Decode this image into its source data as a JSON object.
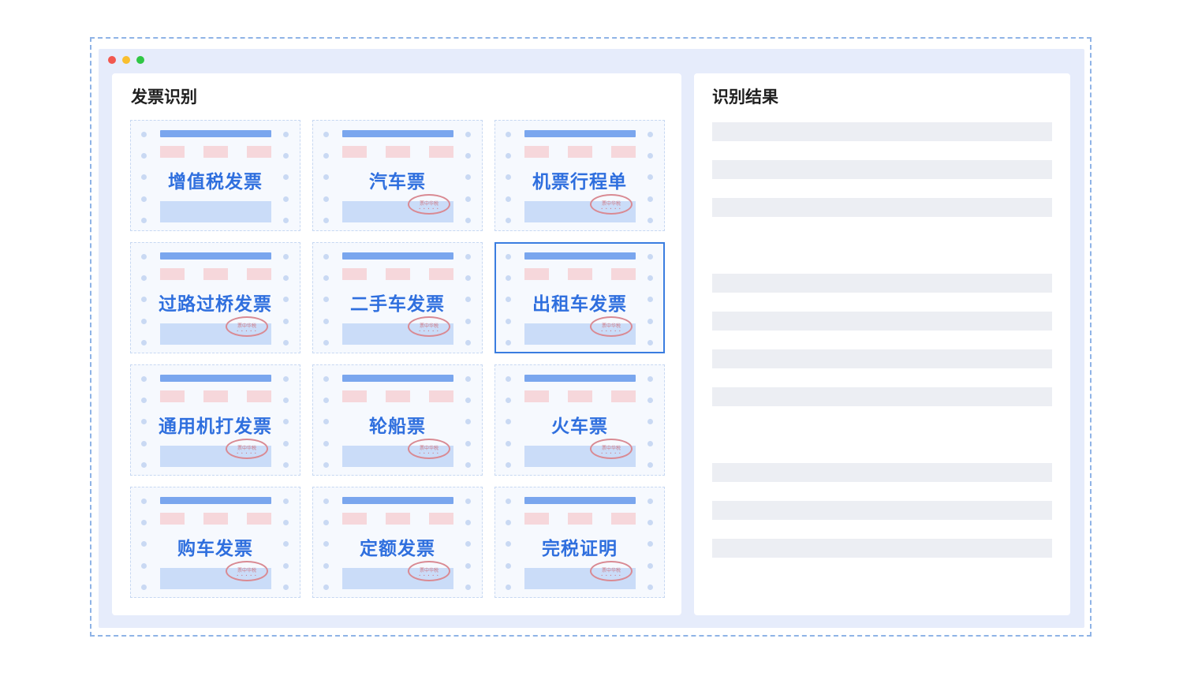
{
  "left_panel": {
    "title": "发票识别"
  },
  "right_panel": {
    "title": "识别结果"
  },
  "stamp_text": "票中华税",
  "stamp_stars": "• • • • •",
  "cards": [
    {
      "label": "增值税发票",
      "stamp": false,
      "selected": false
    },
    {
      "label": "汽车票",
      "stamp": true,
      "selected": false
    },
    {
      "label": "机票行程单",
      "stamp": true,
      "selected": false
    },
    {
      "label": "过路过桥发票",
      "stamp": true,
      "selected": false
    },
    {
      "label": "二手车发票",
      "stamp": true,
      "selected": false
    },
    {
      "label": "出租车发票",
      "stamp": true,
      "selected": true
    },
    {
      "label": "通用机打发票",
      "stamp": true,
      "selected": false
    },
    {
      "label": "轮船票",
      "stamp": true,
      "selected": false
    },
    {
      "label": "火车票",
      "stamp": true,
      "selected": false
    },
    {
      "label": "购车发票",
      "stamp": true,
      "selected": false
    },
    {
      "label": "定额发票",
      "stamp": true,
      "selected": false
    },
    {
      "label": "完税证明",
      "stamp": true,
      "selected": false
    }
  ],
  "colors": {
    "accent": "#3a7de0",
    "label": "#2f6fde",
    "window_bg": "#e6ecfb",
    "stamp": "#d98a93"
  }
}
